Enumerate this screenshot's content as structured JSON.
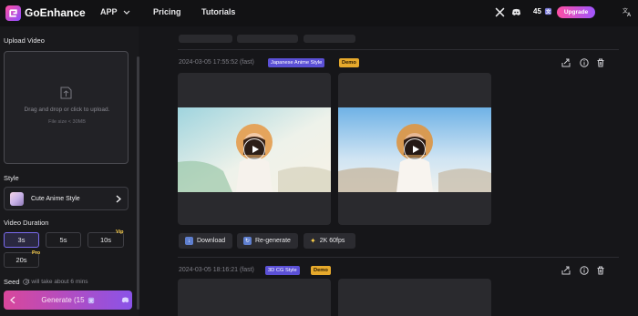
{
  "app": {
    "brand": "GoEnhance"
  },
  "nav": {
    "app_label": "APP",
    "pricing": "Pricing",
    "tutorials": "Tutorials"
  },
  "header": {
    "credits": "45",
    "upgrade": "Upgrade"
  },
  "sidebar": {
    "upload_label": "Upload Video",
    "upload_hint": "Drag and drop or click to upload.",
    "upload_limit": "File size < 30MB",
    "style_label": "Style",
    "style_value": "Cute Anime Style",
    "duration_label": "Video Duration",
    "durations": [
      {
        "label": "3s",
        "badge": ""
      },
      {
        "label": "5s",
        "badge": ""
      },
      {
        "label": "10s",
        "badge": "Vip"
      },
      {
        "label": "20s",
        "badge": "Pro"
      }
    ],
    "seed_label": "Seed",
    "seed_note": "It will take about 6 mins",
    "generate_label": "Generate (15"
  },
  "jobs": [
    {
      "timestamp": "2024-03-05 17:55:52 (fast)",
      "style": "Japanese Anime Style",
      "tag": "Demo",
      "actions": {
        "download": "Download",
        "regenerate": "Re-generate",
        "upscale": "2K 60fps"
      }
    },
    {
      "timestamp": "2024-03-05 18:16:21 (fast)",
      "style": "3D CG Style",
      "tag": "Demo"
    }
  ],
  "colors": {
    "accent": "#7b6cf0",
    "brand_pink": "#ff4fa3",
    "brand_purple": "#8a4dff",
    "demo_badge": "#e6a92c"
  }
}
